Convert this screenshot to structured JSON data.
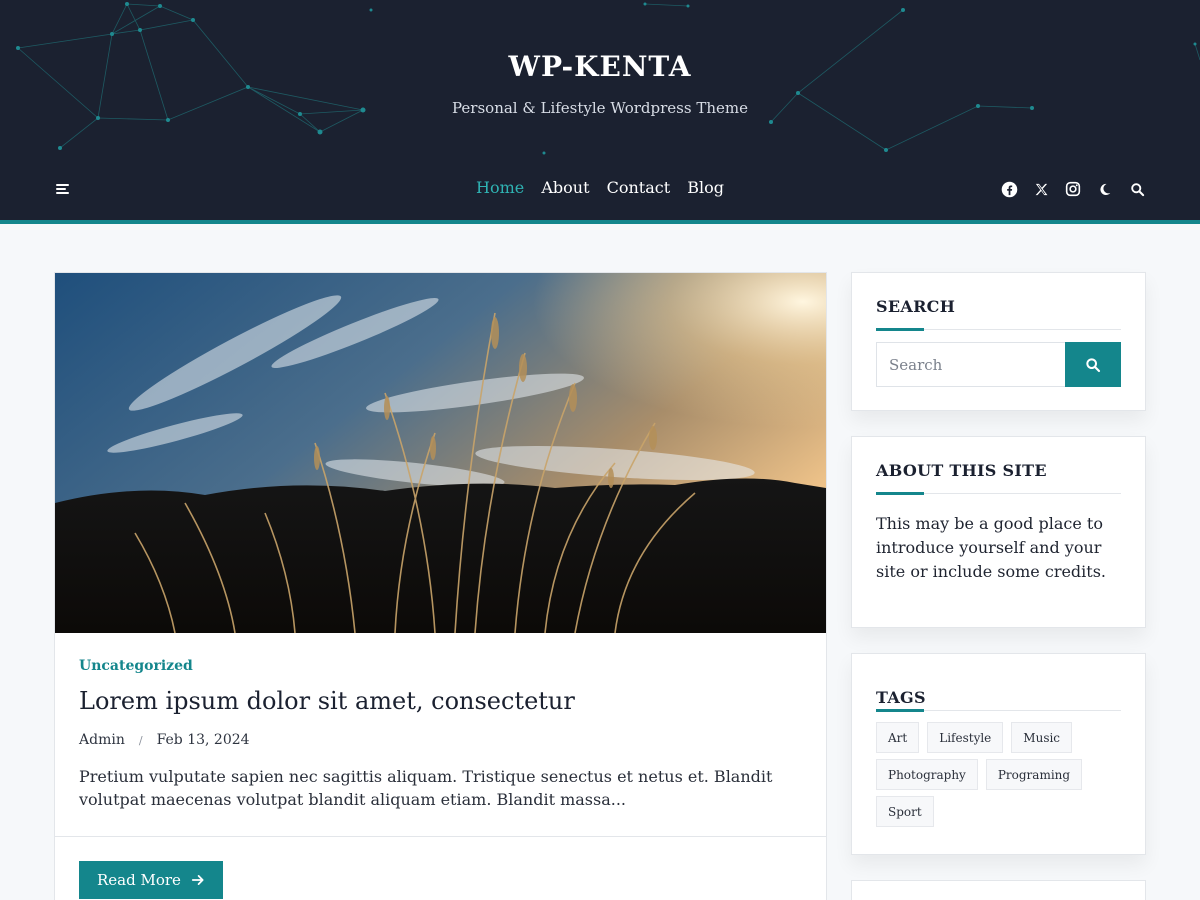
{
  "colors": {
    "header_bg": "#1b2130",
    "accent": "#14868c",
    "nav_active": "#2fb3b3",
    "page_bg": "#f6f8fa"
  },
  "header": {
    "site_title": "WP-KENTA",
    "tagline": "Personal & Lifestyle Wordpress Theme",
    "menu_icon": "hamburger-icon",
    "nav": [
      {
        "label": "Home",
        "active": true
      },
      {
        "label": "About",
        "active": false
      },
      {
        "label": "Contact",
        "active": false
      },
      {
        "label": "Blog",
        "active": false
      }
    ],
    "icons": [
      "facebook-icon",
      "x-twitter-icon",
      "instagram-icon",
      "dark-mode-moon-icon",
      "search-icon"
    ]
  },
  "post": {
    "image": "grass-silhouette-sunset-photo",
    "category": "Uncategorized",
    "title": "Lorem ipsum dolor sit amet, consectetur",
    "author": "Admin",
    "separator": "/",
    "date": "Feb 13, 2024",
    "excerpt": "Pretium vulputate sapien nec sagittis aliquam. Tristique senectus et netus et. Blandit volutpat maecenas volutpat blandit aliquam etiam. Blandit massa...",
    "read_more": "Read More"
  },
  "sidebar": {
    "search": {
      "title": "SEARCH",
      "placeholder": "Search"
    },
    "about": {
      "title": "ABOUT THIS SITE",
      "text": "This may be a good place to introduce yourself and your site or include some credits."
    },
    "tags": {
      "title": "TAGS",
      "items": [
        "Art",
        "Lifestyle",
        "Music",
        "Photography",
        "Programing",
        "Sport"
      ]
    }
  }
}
